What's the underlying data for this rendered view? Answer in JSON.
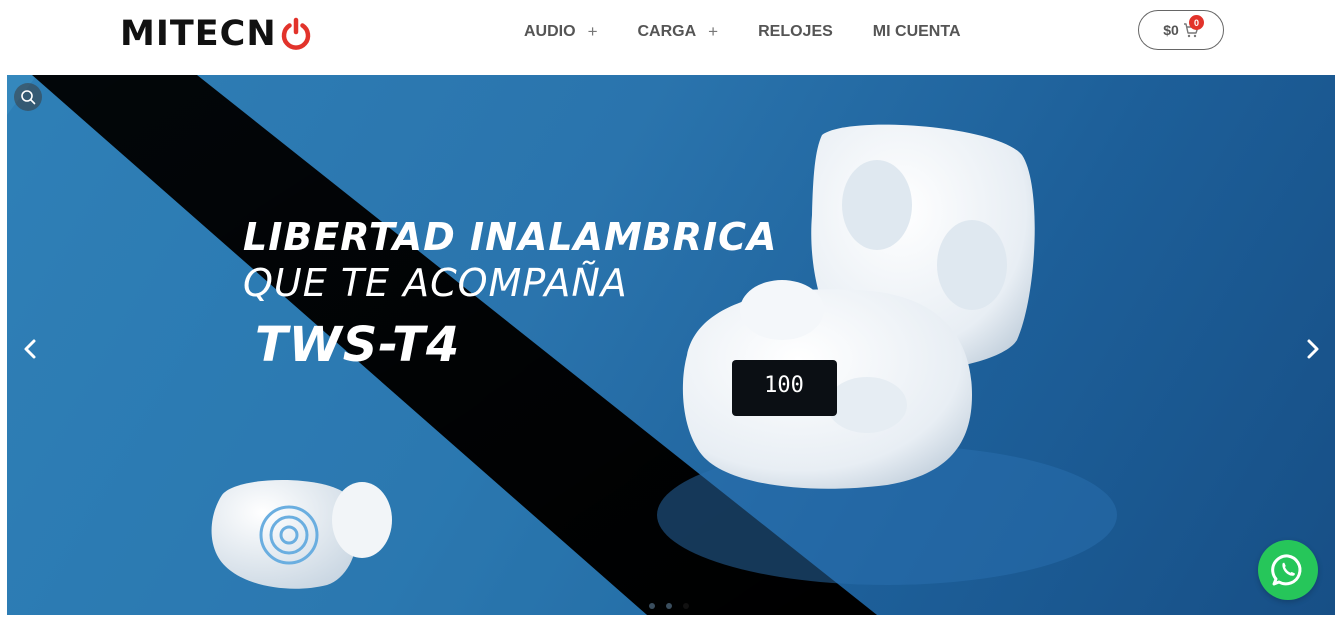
{
  "header": {
    "logo_text": "MITECN",
    "nav": [
      {
        "label": "AUDIO",
        "has_submenu": true,
        "submenu_indicator": "+"
      },
      {
        "label": "CARGA",
        "has_submenu": true,
        "submenu_indicator": "+"
      },
      {
        "label": "RELOJES",
        "has_submenu": false
      },
      {
        "label": "MI CUENTA",
        "has_submenu": false
      }
    ],
    "cart": {
      "price": "$0",
      "count": "0",
      "icon": "cart-icon"
    }
  },
  "hero": {
    "title_line1": "LIBERTAD INALAMBRICA",
    "title_line2": "QUE TE ACOMPAÑA",
    "title_line3": "TWS-T4",
    "case_display": "100",
    "slides_count": 3,
    "active_slide": 3
  },
  "colors": {
    "accent_red": "#e2332b",
    "whatsapp_green": "#26c65a",
    "hero_blue": "#2a74ad",
    "nav_text": "#555555"
  },
  "icons": {
    "search": "search-icon",
    "prev": "chevron-left-icon",
    "next": "chevron-right-icon",
    "whatsapp": "whatsapp-icon",
    "power": "power-icon"
  }
}
